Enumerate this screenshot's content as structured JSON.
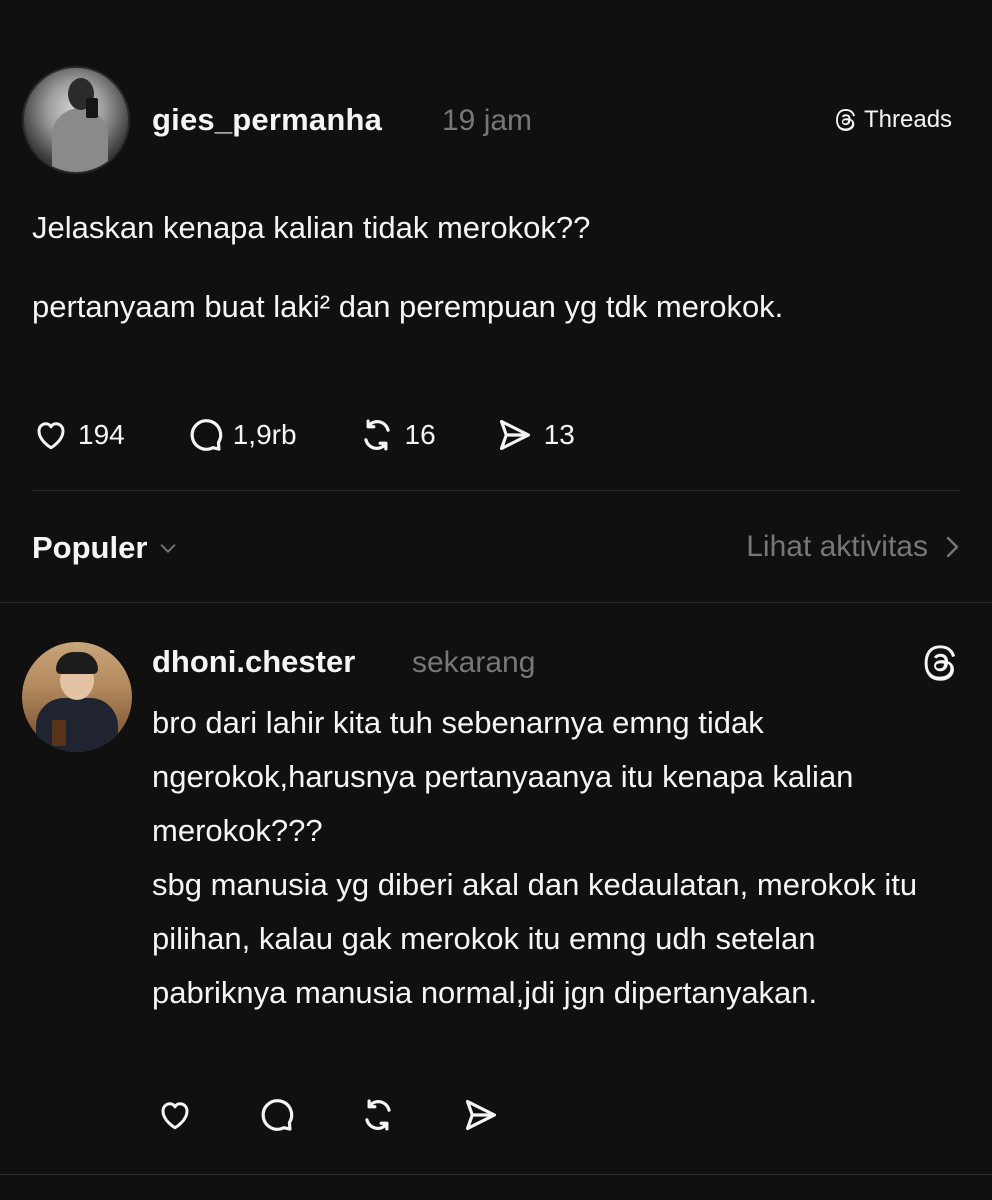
{
  "post": {
    "username": "gies_permanha",
    "time": "19 jam",
    "badge_label": "Threads",
    "title": "Jelaskan kenapa kalian tidak merokok??",
    "body": "pertanyaam buat laki² dan perempuan yg tdk merokok.",
    "actions": {
      "likes": "194",
      "replies": "1,9rb",
      "reposts": "16",
      "shares": "13"
    }
  },
  "sort": {
    "label": "Populer",
    "activity_link": "Lihat aktivitas"
  },
  "reply": {
    "username": "dhoni.chester",
    "time": "sekarang",
    "paragraphs": [
      "bro dari lahir kita tuh sebenarnya emng tidak ngerokok,harusnya pertanyaanya itu kenapa kalian merokok???",
      "sbg manusia yg diberi akal dan kedaulatan, merokok itu pilihan, kalau gak merokok itu emng udh setelan pabriknya manusia normal,jdi jgn dipertanyakan."
    ]
  },
  "icons": {
    "like": "heart-icon",
    "reply": "comment-bubble-icon",
    "repost": "repost-icon",
    "share": "send-icon",
    "brand": "threads-logo-icon",
    "dropdown": "chevron-down-icon",
    "link": "chevron-right-icon"
  },
  "colors": {
    "background": "#101010",
    "text": "#f3f5f7",
    "muted": "#777777"
  }
}
